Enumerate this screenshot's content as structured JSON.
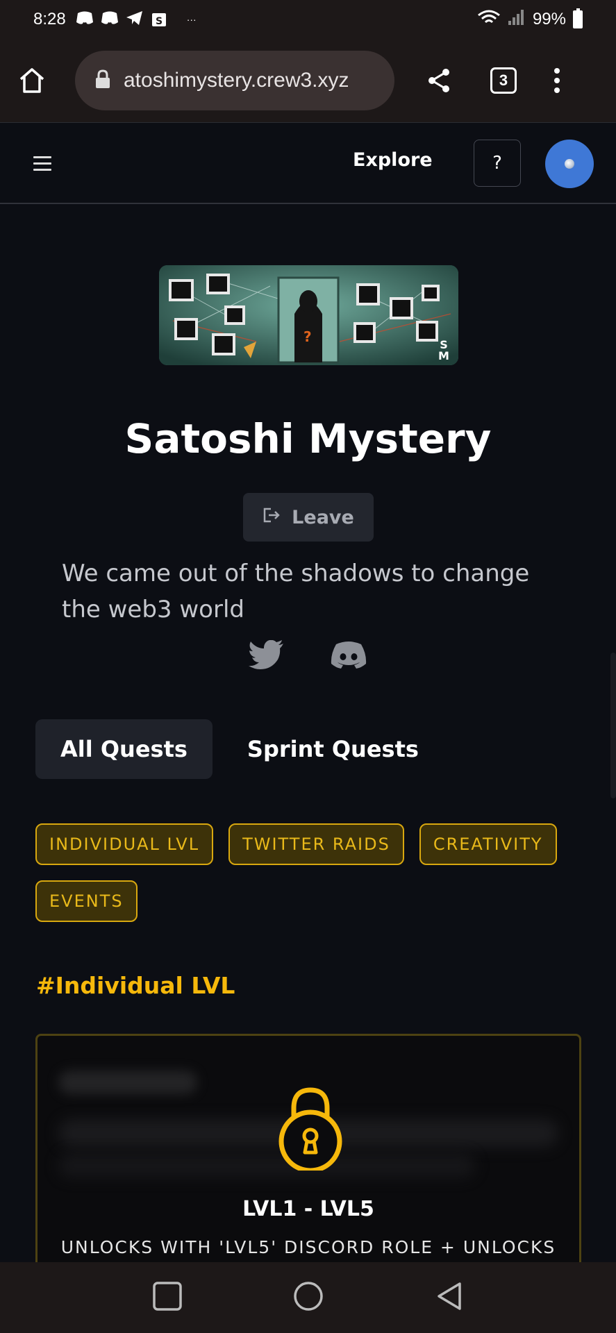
{
  "status_bar": {
    "time": "8:28",
    "more_indicator": "···",
    "battery": "99%"
  },
  "browser": {
    "url": "atoshimystery.crew3.xyz",
    "tab_count": "3"
  },
  "site_nav": {
    "explore_label": "Explore",
    "help_label": "?"
  },
  "community": {
    "name": "Satoshi Mystery",
    "leave_label": "Leave",
    "description": "We came out of the shadows to change the web3 world"
  },
  "tabs": [
    {
      "label": "All Quests",
      "active": true
    },
    {
      "label": "Sprint Quests",
      "active": false
    }
  ],
  "categories": [
    "INDIVIDUAL LVL",
    "TWITTER RAIDS",
    "CREATIVITY",
    "EVENTS"
  ],
  "section_title": "#Individual LVL",
  "quest_card": {
    "title": "LVL1 - LVL5",
    "subtitle": "UNLOCKS WITH 'LVL5' DISCORD ROLE + UNLOCKS"
  },
  "colors": {
    "accent": "#f6b80b",
    "chip_bg": "#3d3209",
    "background": "#0c0e14",
    "avatar": "#3f78d6"
  },
  "icons": [
    "home-icon",
    "lock-icon",
    "share-icon",
    "more-vert-icon",
    "menu-icon",
    "twitter-icon",
    "discord-icon",
    "logout-icon",
    "padlock-icon",
    "nav-recents-icon",
    "nav-home-icon",
    "nav-back-icon"
  ]
}
